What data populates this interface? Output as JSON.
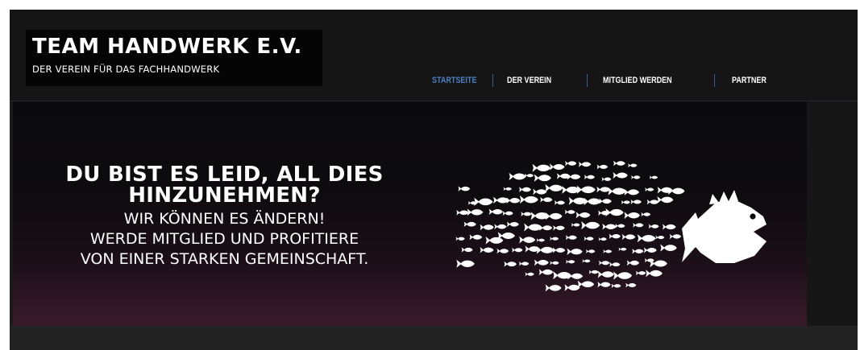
{
  "logo": {
    "title": "TEAM HANDWERK E.V.",
    "subtitle": "DER VEREIN FÜR DAS FACHHANDWERK"
  },
  "nav": {
    "items": [
      {
        "label": "STARTSEITE",
        "active": true
      },
      {
        "label": "DER VEREIN",
        "active": false
      },
      {
        "label": "MITGLIED WERDEN",
        "active": false
      },
      {
        "label": "PARTNER",
        "active": false
      }
    ]
  },
  "hero": {
    "headline_1": "DU BIST ES LEID, ALL DIES",
    "headline_2": "HINZUNEHMEN?",
    "line_1": "WIR KÖNNEN ES ÄNDERN!",
    "line_2": "WERDE MITGLIED UND PROFITIERE",
    "line_3": "VON EINER STARKEN GEMEINSCHAFT.",
    "illustration": "many-small-fish-forming-big-fish-chasing-single-fish"
  },
  "colors": {
    "header_bg": "#151515",
    "logo_bg": "#050505",
    "nav_active": "#4a7fc1",
    "nav_text": "#ffffff",
    "nav_separator": "#3d5d87",
    "hero_text": "#ffffff",
    "fish": "#ffffff"
  }
}
